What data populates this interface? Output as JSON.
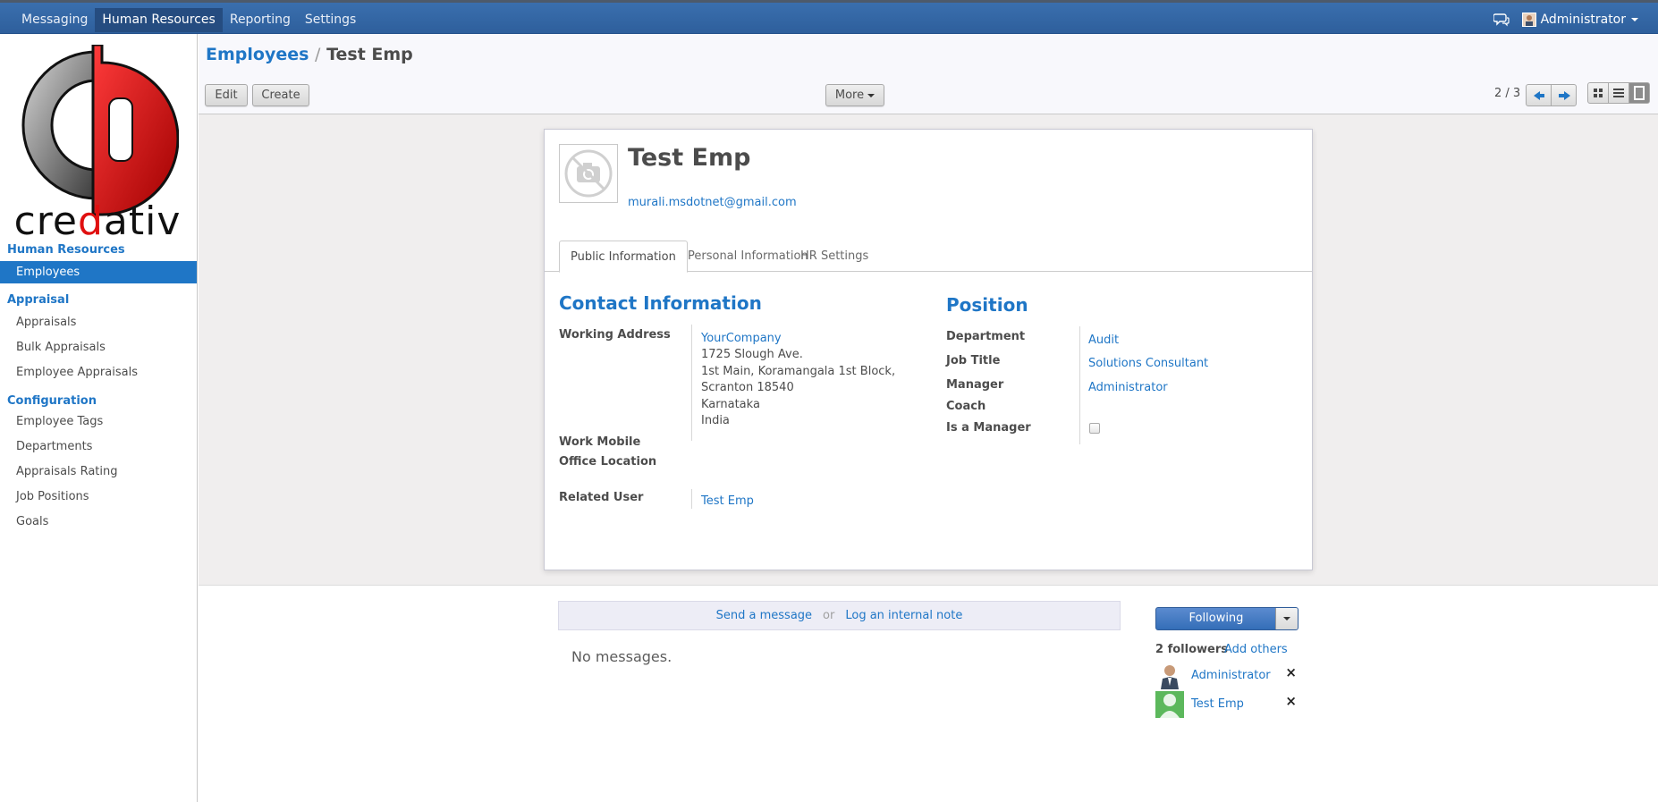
{
  "topbar": {
    "menu": [
      "Messaging",
      "Human Resources",
      "Reporting",
      "Settings"
    ],
    "active": "Human Resources",
    "user": "Administrator",
    "icons": [
      "chat-icon",
      "user-avatar",
      "chevron-down-icon"
    ]
  },
  "sidebar": {
    "logo_text": "credativ",
    "sections": [
      {
        "title": "Human Resources",
        "items": [
          "Employees"
        ]
      },
      {
        "title": "Appraisal",
        "items": [
          "Appraisals",
          "Bulk Appraisals",
          "Employee Appraisals"
        ]
      },
      {
        "title": "Configuration",
        "items": [
          "Employee Tags",
          "Departments",
          "Appraisals Rating",
          "Job Positions",
          "Goals"
        ]
      }
    ],
    "active_item": "Employees"
  },
  "control_panel": {
    "breadcrumb_parent": "Employees",
    "breadcrumb_sep": "/",
    "breadcrumb_current": "Test Emp",
    "edit_label": "Edit",
    "create_label": "Create",
    "more_label": "More",
    "pager": "2 / 3",
    "views": [
      "kanban-view-icon",
      "list-view-icon",
      "form-view-icon"
    ],
    "active_view": "form-view-icon"
  },
  "employee": {
    "name": "Test Emp",
    "email": "murali.msdotnet@gmail.com",
    "tabs": [
      "Public Information",
      "Personal Information",
      "HR Settings"
    ],
    "active_tab": "Public Information",
    "contact": {
      "heading": "Contact Information",
      "working_address_label": "Working Address",
      "company": "YourCompany",
      "address_lines": [
        "1725 Slough Ave.",
        "1st Main, Koramangala 1st Block,",
        "Scranton 18540",
        "Karnataka",
        "India"
      ],
      "work_mobile_label": "Work Mobile",
      "office_location_label": "Office Location",
      "related_user_label": "Related User",
      "related_user": "Test Emp"
    },
    "position": {
      "heading": "Position",
      "department_label": "Department",
      "department": "Audit",
      "job_title_label": "Job Title",
      "job_title": "Solutions Consultant",
      "manager_label": "Manager",
      "manager": "Administrator",
      "coach_label": "Coach",
      "is_manager_label": "Is a Manager",
      "is_manager": false
    }
  },
  "chatter": {
    "send_message": "Send a message",
    "or": "or",
    "log_note": "Log an internal note",
    "no_messages": "No messages.",
    "following_label": "Following",
    "followers_count": "2 followers",
    "add_others": "Add others",
    "followers": [
      "Administrator",
      "Test Emp"
    ],
    "remove_glyph": "×"
  },
  "colors": {
    "navbar": "#2e5f9c",
    "accent": "#1f76c6"
  }
}
